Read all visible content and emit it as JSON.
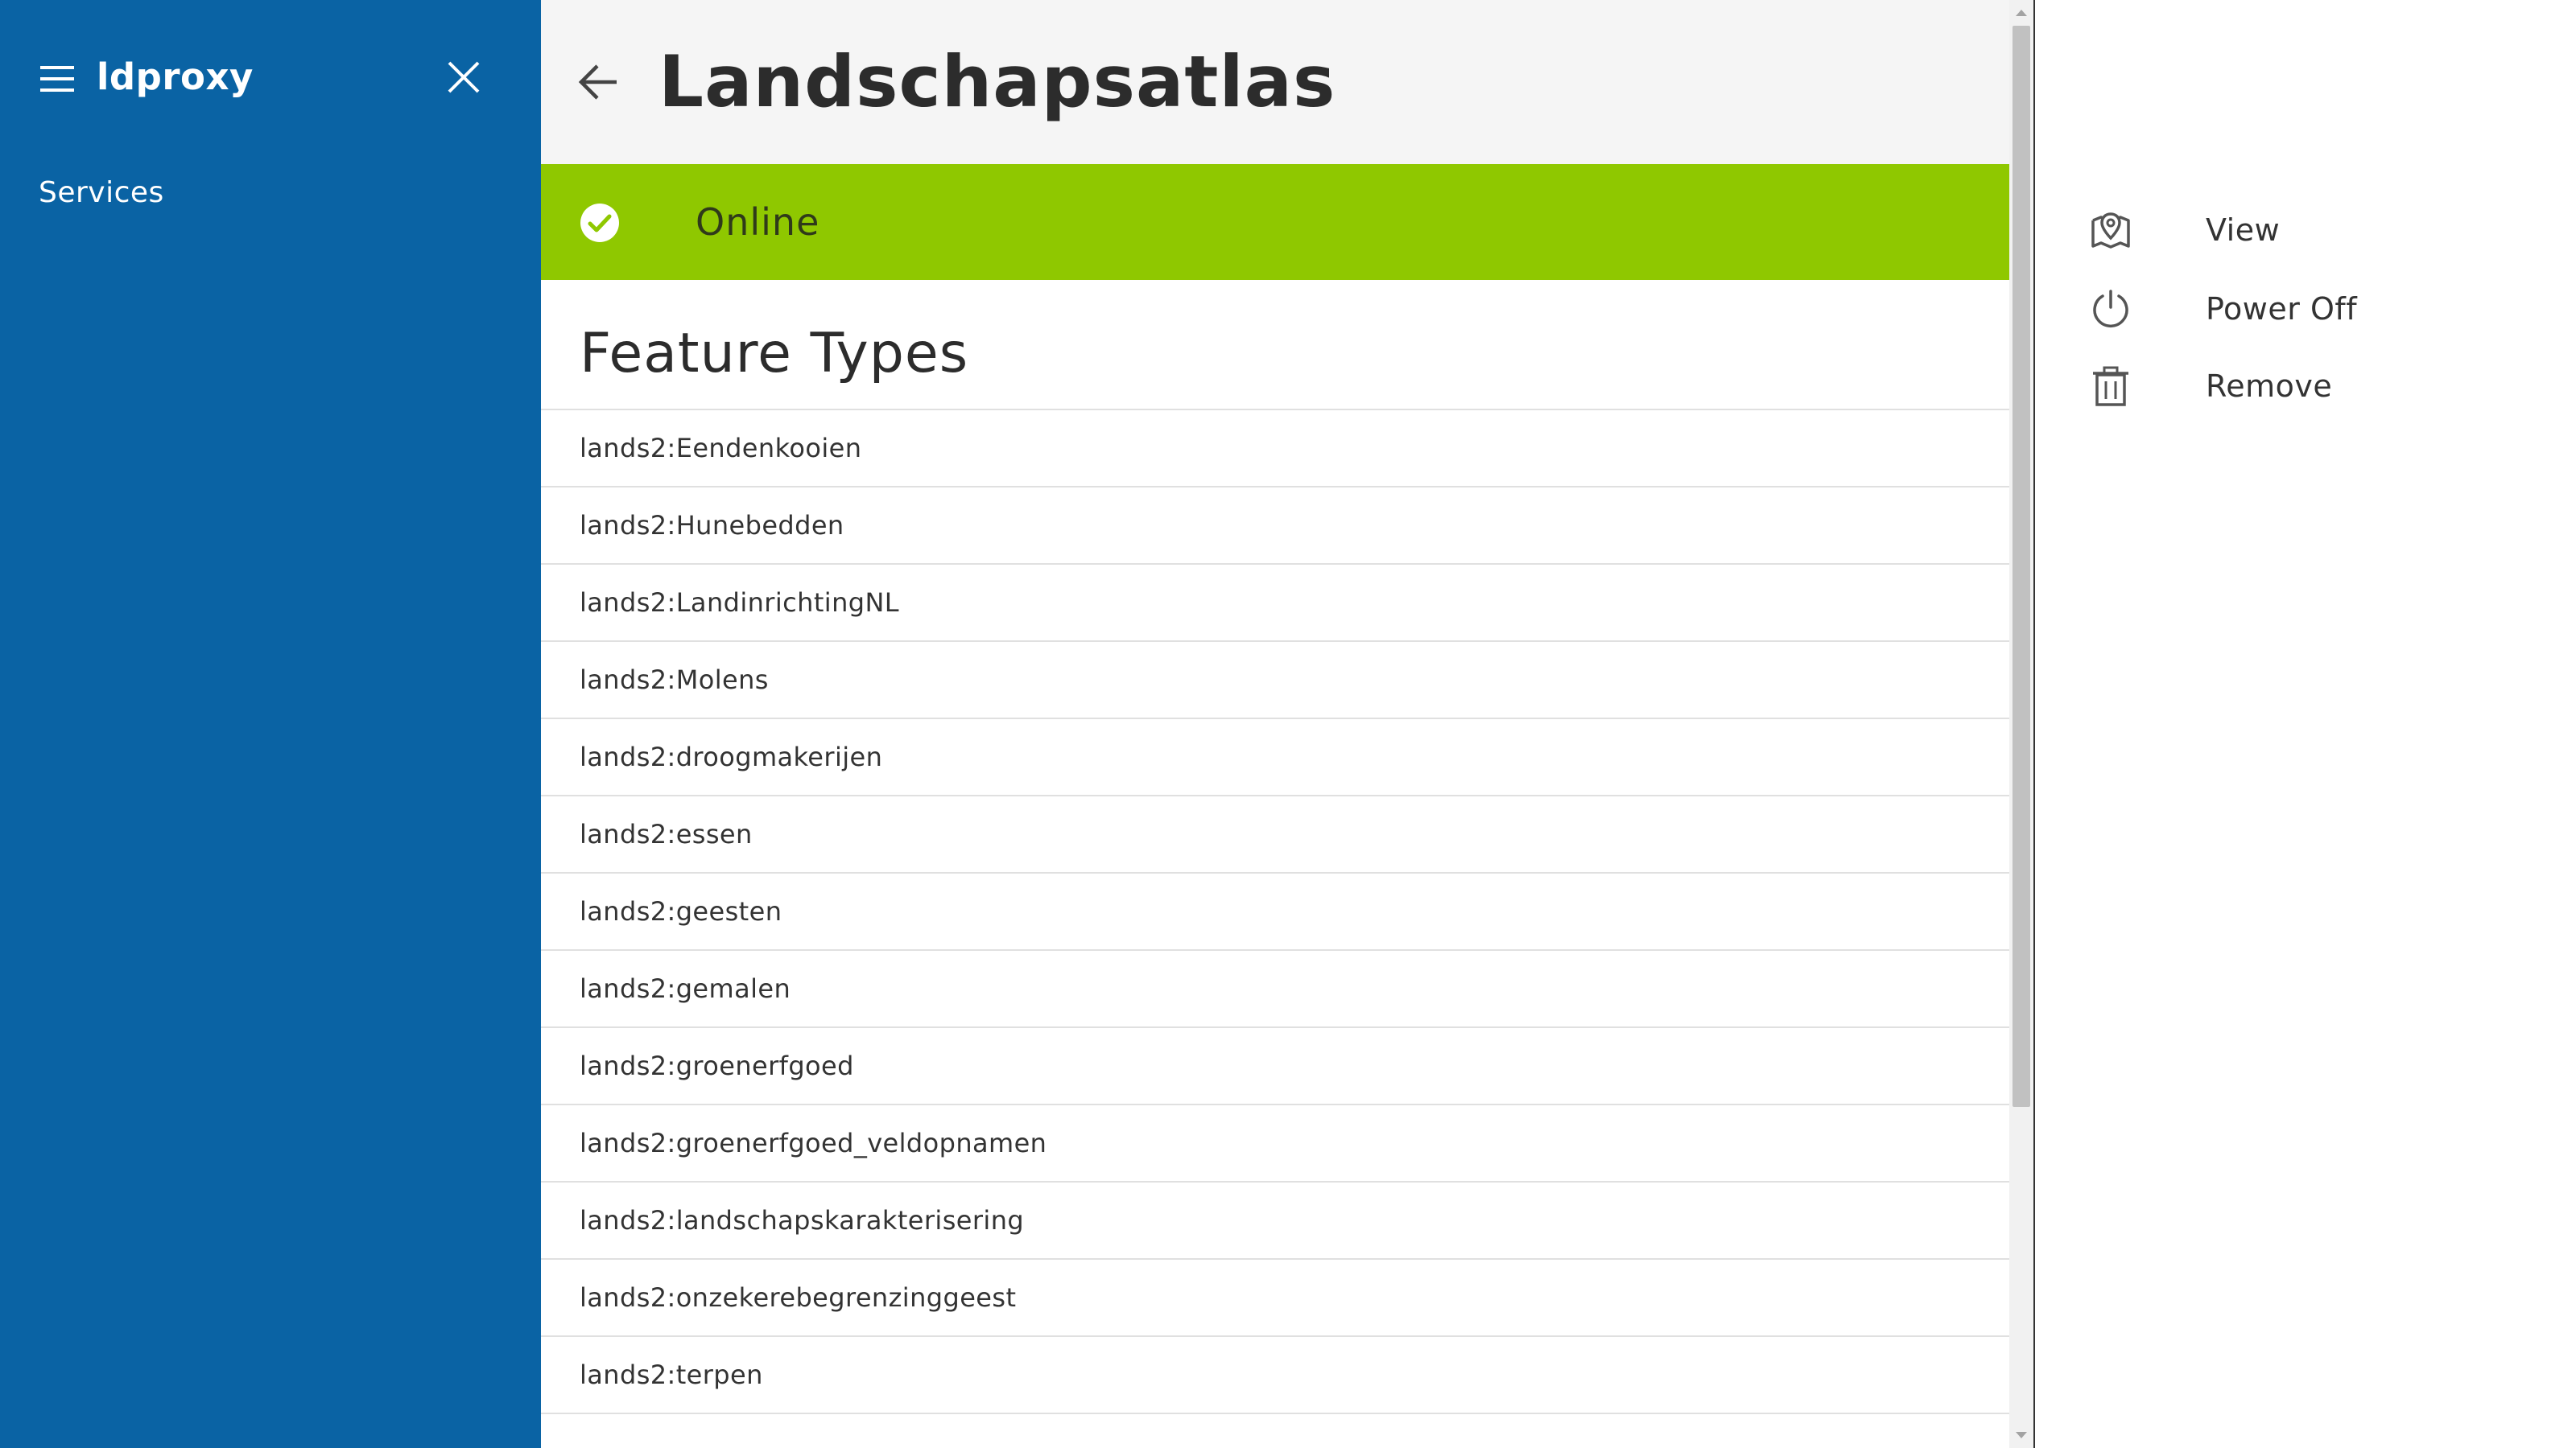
{
  "app": {
    "brand": "ldproxy"
  },
  "sidebar": {
    "items": [
      {
        "label": "Services"
      }
    ]
  },
  "header": {
    "title": "Landschapsatlas"
  },
  "status": {
    "label": "Online",
    "color": "#8fc800"
  },
  "feature_types": {
    "title": "Feature Types",
    "items": [
      "lands2:Eendenkooien",
      "lands2:Hunebedden",
      "lands2:LandinrichtingNL",
      "lands2:Molens",
      "lands2:droogmakerijen",
      "lands2:essen",
      "lands2:geesten",
      "lands2:gemalen",
      "lands2:groenerfgoed",
      "lands2:groenerfgoed_veldopnamen",
      "lands2:landschapskarakterisering",
      "lands2:onzekerebegrenzinggeest",
      "lands2:terpen"
    ]
  },
  "actions": {
    "view": {
      "label": "View",
      "icon": "map-pin-icon"
    },
    "power_off": {
      "label": "Power Off",
      "icon": "power-icon"
    },
    "remove": {
      "label": "Remove",
      "icon": "trash-icon"
    }
  },
  "colors": {
    "sidebar": "#0a63a4",
    "status_online": "#8fc800"
  }
}
